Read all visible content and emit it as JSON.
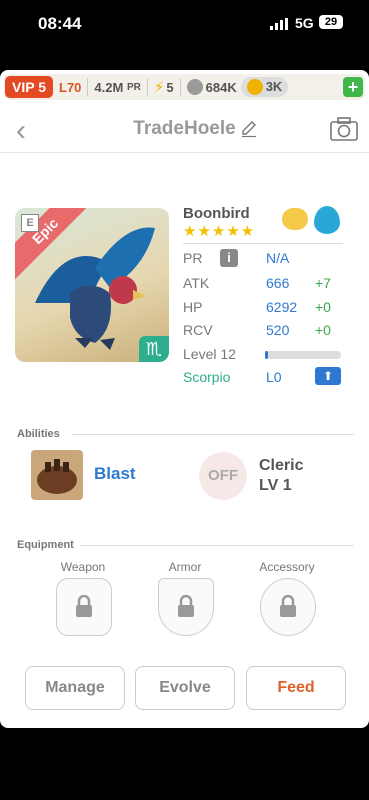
{
  "status": {
    "time": "08:44",
    "network": "5G",
    "battery": "29"
  },
  "topbar": {
    "vip": "VIP 5",
    "level": "L70",
    "power": "4.2M",
    "power_unit": "PR",
    "energy": "5",
    "silver": "684K",
    "gold": "3K"
  },
  "header": {
    "title": "TradeHoele"
  },
  "monster": {
    "rarity": "Epic",
    "name": "Boonbird",
    "stars": "★★★★★",
    "stats": {
      "pr": {
        "label": "PR",
        "value": "N/A"
      },
      "atk": {
        "label": "ATK",
        "value": "666",
        "bonus": "+7"
      },
      "hp": {
        "label": "HP",
        "value": "6292",
        "bonus": "+0"
      },
      "rcv": {
        "label": "RCV",
        "value": "520",
        "bonus": "+0"
      },
      "level": {
        "label": "Level 12",
        "progress": 0.04
      },
      "sign": {
        "label": "Scorpio",
        "value": "L0"
      }
    }
  },
  "abilities": {
    "title": "Abilities",
    "items": [
      {
        "name": "Blast"
      },
      {
        "badge": "OFF",
        "name": "Cleric",
        "level": "LV 1"
      }
    ]
  },
  "equipment": {
    "title": "Equipment",
    "slots": [
      "Weapon",
      "Armor",
      "Accessory"
    ]
  },
  "actions": {
    "manage": "Manage",
    "evolve": "Evolve",
    "feed": "Feed"
  },
  "colors": {
    "accent_blue": "#2f7ad0",
    "positive_green": "#3aa84a",
    "feed_orange": "#e0622a",
    "vip_red": "#e34a21"
  }
}
